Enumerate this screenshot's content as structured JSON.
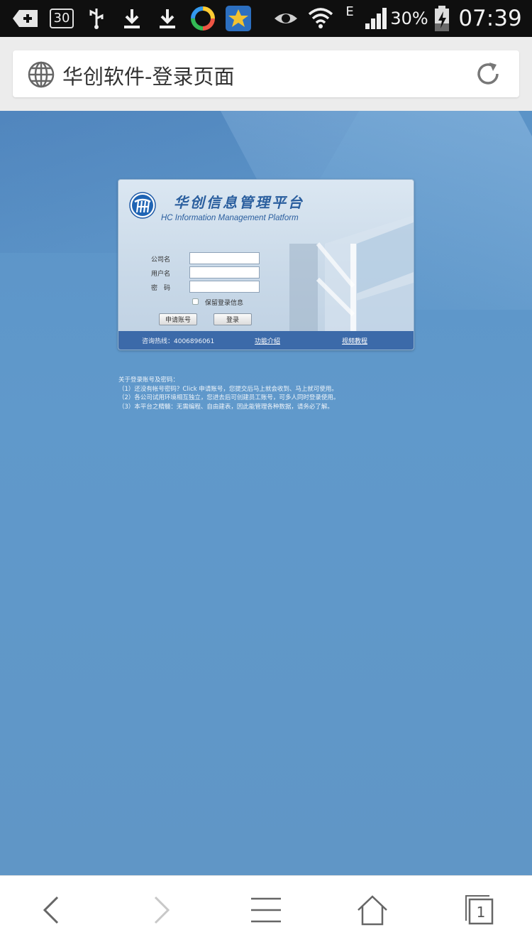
{
  "status_bar": {
    "notification_count": "30",
    "network_type": "E",
    "battery": "30%",
    "time": "07:39"
  },
  "browser": {
    "page_title": "华创软件-登录页面"
  },
  "login": {
    "brand_cn": "华创信息管理平台",
    "brand_en": "HC Information Management Platform",
    "company_label": "公司名",
    "username_label": "用户名",
    "password_label": "密　码",
    "company_value": "",
    "username_value": "",
    "password_value": "",
    "remember_label": "保留登录信息",
    "remember_checked": false,
    "apply_button": "申请账号",
    "login_button": "登录",
    "hotline": "咨询热线：4006896061",
    "features_link": "功能介绍",
    "video_link": "视频教程"
  },
  "notes": {
    "heading": "关于登录账号及密码：",
    "lines": [
      "（1）还没有帐号密码？Click 申请账号，您提交后马上就会收到、马上就可使用。",
      "（2）各公司试用环境相互独立，您进去后可创建员工账号，可多人同时登录使用。",
      "（3）本平台之精髓：无需编程、自由建表，因此能管理各种数据，请务必了解。"
    ]
  },
  "bottom_nav": {
    "tab_count": "1"
  },
  "colors": {
    "page_background": "#6096c6",
    "panel_footer": "#3c6aa9",
    "brand_text": "#2a5e9e",
    "status_bar": "#0f0f0f"
  },
  "icons": {
    "status_bar": [
      "add-icon",
      "notification-count-icon",
      "usb-icon",
      "download-icon",
      "download-icon",
      "app-icon",
      "star-app-icon",
      "eye-icon",
      "wifi-icon",
      "signal-icon",
      "battery-charging-icon"
    ],
    "address_bar": [
      "globe-icon",
      "refresh-icon"
    ],
    "bottom_nav": [
      "back-icon",
      "forward-icon",
      "menu-icon",
      "home-icon",
      "tabs-icon"
    ]
  }
}
